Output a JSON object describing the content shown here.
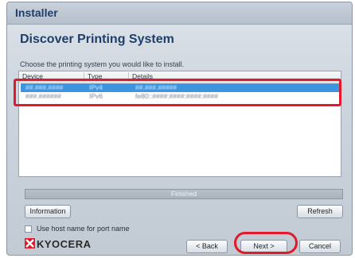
{
  "window": {
    "title": "Installer"
  },
  "page": {
    "heading": "Discover Printing System",
    "instruction": "Choose the printing system you would like to install."
  },
  "device_list": {
    "columns": [
      "Device",
      "Type",
      "Details"
    ],
    "rows": [
      {
        "device": "##.###.####",
        "type": "IPv4",
        "details": "##.###.#####",
        "selected": true
      },
      {
        "device": "###.######",
        "type": "IPv6",
        "details": "fe80::####:####:####:####",
        "selected": false
      }
    ]
  },
  "status": {
    "text": "Finished"
  },
  "buttons": {
    "information": "Information",
    "refresh": "Refresh",
    "back": "< Back",
    "next": "Next >",
    "cancel": "Cancel"
  },
  "options": {
    "use_host_name_label": "Use host name for port name",
    "use_host_name_checked": false
  },
  "brand": {
    "logo_text": "KYOCERA",
    "logo_color": "#e0192b"
  },
  "colors": {
    "accent_heading": "#1e3f6a",
    "selection": "#3d95e0",
    "annotation": "#e0192b"
  }
}
